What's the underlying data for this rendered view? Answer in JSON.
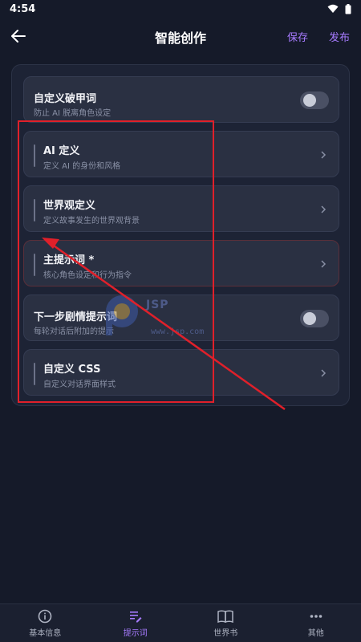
{
  "status_bar": {
    "time": "4:54",
    "wifi_icon": "wifi-icon",
    "battery_icon": "battery-icon"
  },
  "app_bar": {
    "title": "智能创作",
    "save_label": "保存",
    "publish_label": "发布",
    "accent_color": "#a77bff"
  },
  "rows": [
    {
      "title": "自定义破甲词",
      "subtitle": "防止 AI 脱离角色设定",
      "type": "toggle",
      "on": false
    },
    {
      "title": "AI 定义",
      "subtitle": "定义 AI 的身份和风格",
      "type": "nav"
    },
    {
      "title": "世界观定义",
      "subtitle": "定义故事发生的世界观背景",
      "type": "nav"
    },
    {
      "title": "主提示词 *",
      "subtitle": "核心角色设定和行为指令",
      "type": "nav"
    },
    {
      "title": "下一步剧情提示词",
      "subtitle": "每轮对话后附加的提示",
      "type": "toggle",
      "on": false
    },
    {
      "title": "自定义 CSS",
      "subtitle": "自定义对话界面样式",
      "type": "nav"
    }
  ],
  "watermark": {
    "line1": "JSP",
    "line2": "www.jsp.com"
  },
  "bottom_nav": [
    {
      "label": "基本信息",
      "icon": "info-icon",
      "active": false
    },
    {
      "label": "提示词",
      "icon": "edit-note-icon",
      "active": true
    },
    {
      "label": "世界书",
      "icon": "book-icon",
      "active": false
    },
    {
      "label": "其他",
      "icon": "more-icon",
      "active": false
    }
  ]
}
